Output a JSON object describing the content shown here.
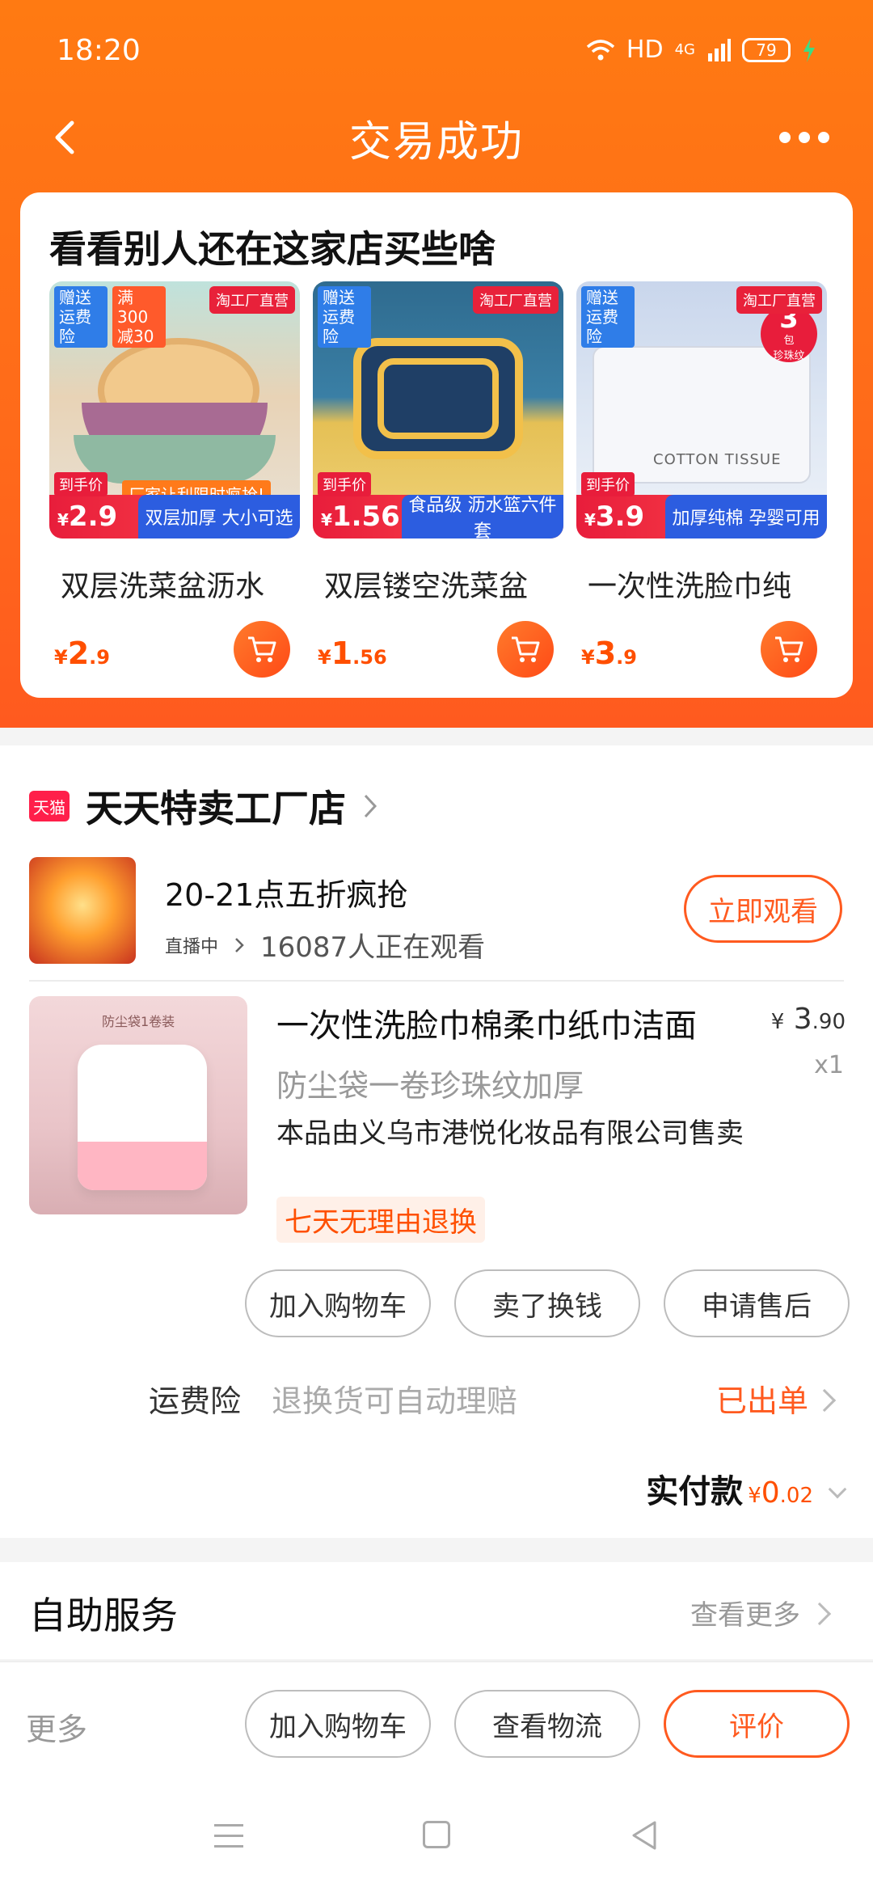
{
  "status_bar": {
    "time": "18:20",
    "network": "HD",
    "signal": "4G",
    "battery": "79"
  },
  "header": {
    "title": "交易成功"
  },
  "recommend": {
    "title": "看看别人还在这家店买些啥",
    "items": [
      {
        "name": "双层洗菜盆沥水",
        "price_int": "2",
        "price_dec": ".9",
        "currency": "¥",
        "badge_left": "赠送运费险",
        "badge_left2": "满300减30",
        "badge_right": "淘工厂直营",
        "strip_label": "到手价",
        "strip_price": "2.9",
        "strip_desc": "双层加厚 大小可选",
        "promo_text": "厂家让利限时疯抢!"
      },
      {
        "name": "双层镂空洗菜盆",
        "price_int": "1",
        "price_dec": ".56",
        "currency": "¥",
        "badge_left": "赠送运费险",
        "badge_right": "淘工厂直营",
        "strip_label": "到手价",
        "strip_price": "1.56",
        "strip_desc": "食品级 沥水篮六件套"
      },
      {
        "name": "一次性洗脸巾纯",
        "price_int": "3",
        "price_dec": ".9",
        "currency": "¥",
        "badge_left": "赠送运费险",
        "badge_right": "淘工厂直营",
        "strip_label": "到手价",
        "strip_price": "3.9",
        "strip_desc": "加厚纯棉 孕婴可用",
        "image_text": "COTTON TISSUE",
        "circle_num": "3",
        "circle_unit": "包",
        "circle_text": "珍珠纹"
      }
    ]
  },
  "shop": {
    "badge": "天猫",
    "name": "天天特卖工厂店",
    "live_title": "20-21点五折疯抢",
    "live_status": "直播中",
    "live_viewers": "16087人正在观看",
    "watch_label": "立即观看"
  },
  "product": {
    "title": "一次性洗脸巾棉柔巾纸巾洁面",
    "subtitle": "防尘袋一卷珍珠纹加厚",
    "seller": "本品由义乌市港悦化妆品有限公司售卖",
    "return_tag": "七天无理由退换",
    "price_currency": "¥",
    "price_int": "3",
    "price_dec": ".90",
    "qty": "x1",
    "image_text": "防尘袋1卷装"
  },
  "actions": {
    "add_cart": "加入购物车",
    "sell": "卖了换钱",
    "after_sale": "申请售后"
  },
  "insurance": {
    "label": "运费险",
    "desc": "退换货可自动理赔",
    "status": "已出单"
  },
  "payment": {
    "label": "实付款",
    "currency": "¥",
    "int": "0",
    "dec": ".02"
  },
  "service": {
    "title": "自助服务",
    "more": "查看更多"
  },
  "bottom_bar": {
    "more": "更多",
    "add_cart": "加入购物车",
    "logistics": "查看物流",
    "review": "评价"
  },
  "colors": {
    "accent": "#ff5a1f",
    "price": "#ff4f00",
    "header_gradient_start": "#ff7a12"
  }
}
